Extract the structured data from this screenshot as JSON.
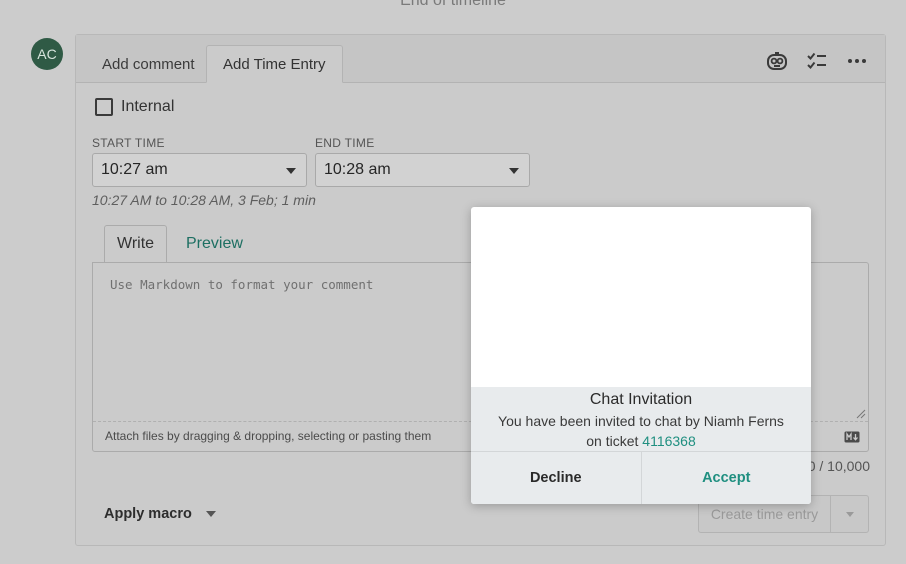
{
  "timeline": {
    "end_text": "End of timeline"
  },
  "avatar": {
    "initials": "AC",
    "color": "#2f5a45"
  },
  "tabs": [
    {
      "label": "Add comment",
      "active": false
    },
    {
      "label": "Add Time Entry",
      "active": true
    }
  ],
  "toolbar": {
    "icons": [
      "copilot-icon",
      "checklist-icon",
      "more-options-icon"
    ]
  },
  "time_entry": {
    "internal_label": "Internal",
    "internal_checked": false,
    "start_label": "START TIME",
    "start_value": "10:27 am",
    "end_label": "END TIME",
    "end_value": "10:28 am",
    "summary": "10:27 AM to 10:28 AM, 3 Feb; 1 min"
  },
  "editor": {
    "write_tab": "Write",
    "preview_tab": "Preview",
    "placeholder": "Use Markdown to format your comment",
    "attach_hint": "Attach files by dragging & dropping, selecting or pasting them",
    "char_count": "0 / 10,000"
  },
  "footer": {
    "macro_label": "Apply macro",
    "create_label": "Create time entry"
  },
  "modal": {
    "title": "Chat Invitation",
    "message": "You have been invited to chat by Niamh Ferns on ticket",
    "ticket": "4116368",
    "decline_label": "Decline",
    "accept_label": "Accept",
    "accent_color": "#1f8f80"
  }
}
